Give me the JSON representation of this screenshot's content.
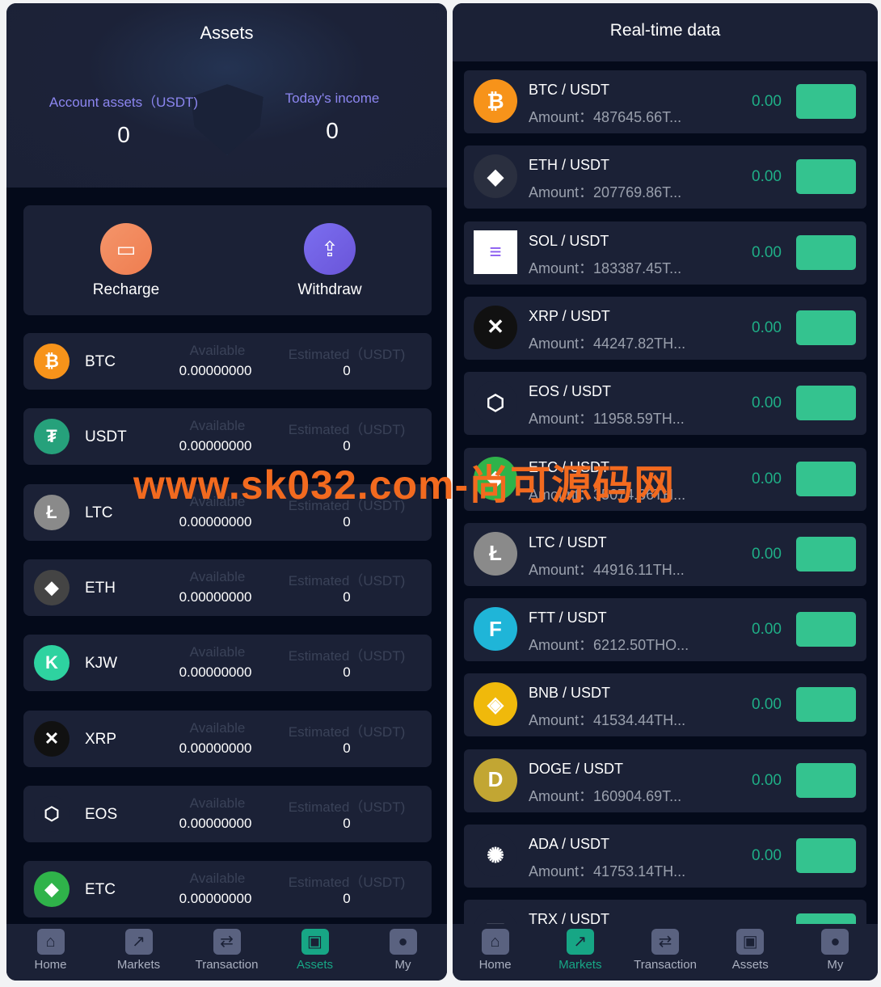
{
  "assets": {
    "title": "Assets",
    "account_label": "Account assets（USDT)",
    "account_value": "0",
    "income_label": "Today's income",
    "income_value": "0",
    "recharge": "Recharge",
    "withdraw": "Withdraw",
    "available_label": "Available",
    "estimated_label": "Estimated（USDT)",
    "coins": [
      {
        "name": "BTC",
        "available": "0.00000000",
        "estimated": "0",
        "icon": "bitcoin-icon",
        "color": "#f7931a"
      },
      {
        "name": "USDT",
        "available": "0.00000000",
        "estimated": "0",
        "icon": "tether-icon",
        "color": "#26a17b"
      },
      {
        "name": "LTC",
        "available": "0.00000000",
        "estimated": "0",
        "icon": "litecoin-icon",
        "color": "#8a8a8a"
      },
      {
        "name": "ETH",
        "available": "0.00000000",
        "estimated": "0",
        "icon": "ethereum-icon",
        "color": "#444"
      },
      {
        "name": "KJW",
        "available": "0.00000000",
        "estimated": "0",
        "icon": "kjw-icon",
        "color": "#2ed3a0"
      },
      {
        "name": "XRP",
        "available": "0.00000000",
        "estimated": "0",
        "icon": "xrp-icon",
        "color": "#111"
      },
      {
        "name": "EOS",
        "available": "0.00000000",
        "estimated": "0",
        "icon": "eos-icon",
        "color": "#1b2136"
      },
      {
        "name": "ETC",
        "available": "0.00000000",
        "estimated": "0",
        "icon": "etc-icon",
        "color": "#2fb34a"
      }
    ]
  },
  "markets": {
    "title": "Real-time data",
    "amount_label": "Amount：",
    "rows": [
      {
        "pair": "BTC / USDT",
        "amount": "487645.66T...",
        "change": "0.00",
        "icon": "bitcoin-icon",
        "color": "#f7931a"
      },
      {
        "pair": "ETH / USDT",
        "amount": "207769.86T...",
        "change": "0.00",
        "icon": "ethereum-icon",
        "color": "#2a2f3f"
      },
      {
        "pair": "SOL / USDT",
        "amount": "183387.45T...",
        "change": "0.00",
        "icon": "solana-icon",
        "color": "#ffffff"
      },
      {
        "pair": "XRP / USDT",
        "amount": "44247.82TH...",
        "change": "0.00",
        "icon": "xrp-icon",
        "color": "#111111"
      },
      {
        "pair": "EOS / USDT",
        "amount": "11958.59TH...",
        "change": "0.00",
        "icon": "eos-icon",
        "color": "#1b2136"
      },
      {
        "pair": "ETC / USDT",
        "amount": "35074.66TH...",
        "change": "0.00",
        "icon": "etc-icon",
        "color": "#2fb34a"
      },
      {
        "pair": "LTC / USDT",
        "amount": "44916.11TH...",
        "change": "0.00",
        "icon": "litecoin-icon",
        "color": "#8a8a8a"
      },
      {
        "pair": "FTT / USDT",
        "amount": "6212.50THO...",
        "change": "0.00",
        "icon": "ftt-icon",
        "color": "#1fb5d8"
      },
      {
        "pair": "BNB / USDT",
        "amount": "41534.44TH...",
        "change": "0.00",
        "icon": "bnb-icon",
        "color": "#f0b90b"
      },
      {
        "pair": "DOGE / USDT",
        "amount": "160904.69T...",
        "change": "0.00",
        "icon": "doge-icon",
        "color": "#c2a633"
      },
      {
        "pair": "ADA / USDT",
        "amount": "41753.14TH...",
        "change": "0.00",
        "icon": "cardano-icon",
        "color": "#1b2136"
      },
      {
        "pair": "TRX / USDT",
        "amount": "",
        "change": "",
        "icon": "tron-icon",
        "color": "#1b2136"
      }
    ]
  },
  "nav": {
    "items": [
      "Home",
      "Markets",
      "Transaction",
      "Assets",
      "My"
    ],
    "left_active": "Assets",
    "right_active": "Markets"
  },
  "watermark": "www.sk032.com-尚可源码网",
  "colors": {
    "accent": "#17a685",
    "up": "#34c38f",
    "label": "#8c86f0"
  }
}
